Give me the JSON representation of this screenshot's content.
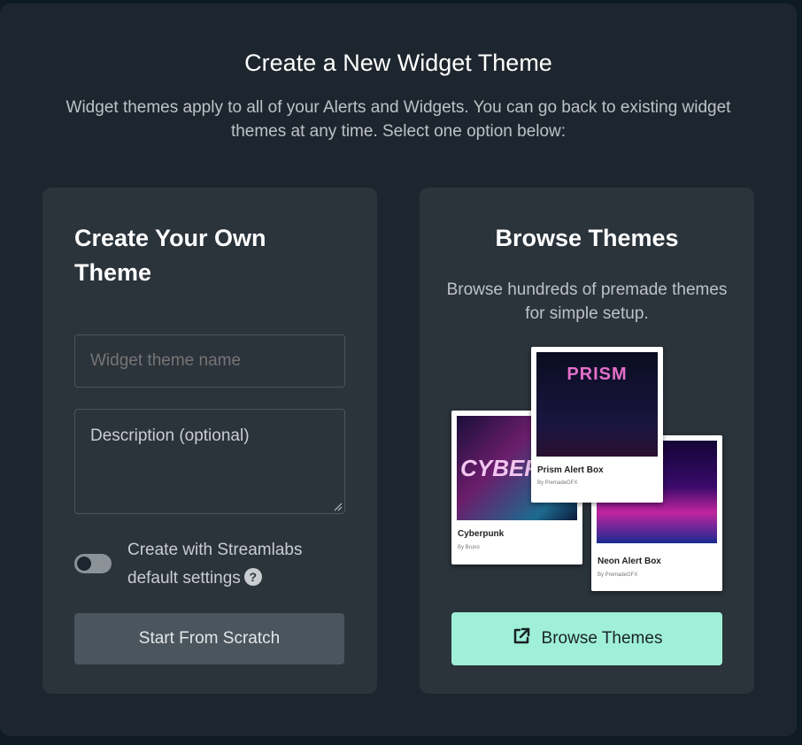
{
  "modal": {
    "title": "Create a New Widget Theme",
    "subtitle": "Widget themes apply to all of your Alerts and Widgets. You can go back to existing widget themes at any time. Select one option below:"
  },
  "create_card": {
    "title": "Create Your Own Theme",
    "name_placeholder": "Widget theme name",
    "description_placeholder": "Description (optional)",
    "toggle_label": "Create with Streamlabs default settings",
    "toggle_on": false,
    "help_glyph": "?",
    "button_label": "Start From Scratch"
  },
  "browse_card": {
    "title": "Browse Themes",
    "description": "Browse hundreds of premade themes for simple setup.",
    "thumbnails": [
      {
        "name": "Cyberpunk",
        "author": "By Bruno",
        "art_text": "CYBERP"
      },
      {
        "name": "Prism Alert Box",
        "author": "By PremadeGFX",
        "art_text": "PRISM"
      },
      {
        "name": "Neon Alert Box",
        "author": "By PremadeGFX"
      }
    ],
    "button_label": "Browse Themes",
    "button_icon": "external-link-icon"
  },
  "colors": {
    "accent": "#9ff0d6",
    "card_bg": "#2b333b",
    "modal_bg": "#1d262e"
  }
}
